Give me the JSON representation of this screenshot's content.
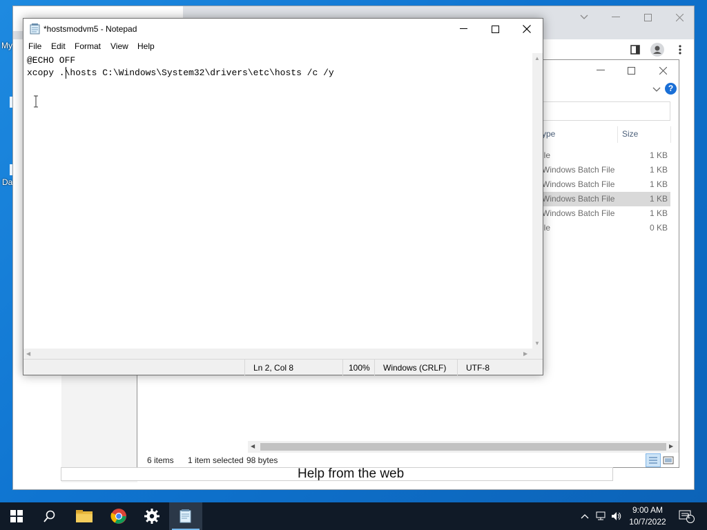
{
  "desktop": {
    "icon_labels": [
      "My",
      "Da"
    ]
  },
  "browser": {
    "help_from_web": "Help from the web"
  },
  "explorer": {
    "column_type": "ype",
    "column_size": "Size",
    "rows": [
      {
        "type": "ile",
        "size": "1 KB",
        "selected": false
      },
      {
        "type": "Windows Batch File",
        "size": "1 KB",
        "selected": false
      },
      {
        "type": "Windows Batch File",
        "size": "1 KB",
        "selected": false
      },
      {
        "type": "Windows Batch File",
        "size": "1 KB",
        "selected": true
      },
      {
        "type": "Windows Batch File",
        "size": "1 KB",
        "selected": false
      },
      {
        "type": "ile",
        "size": "0 KB",
        "selected": false
      }
    ],
    "status": {
      "items": "6 items",
      "selected": "1 item selected",
      "size": "98 bytes"
    }
  },
  "notepad": {
    "title": "*hostsmodvm5 - Notepad",
    "menu": [
      "File",
      "Edit",
      "Format",
      "View",
      "Help"
    ],
    "lines": [
      "@ECHO OFF",
      "xcopy .\\hosts C:\\Windows\\System32\\drivers\\etc\\hosts /c /y"
    ],
    "status": {
      "position": "Ln 2, Col 8",
      "zoom": "100%",
      "line_ending": "Windows (CRLF)",
      "encoding": "UTF-8"
    }
  },
  "taskbar": {
    "time": "9:00 AM",
    "date": "10/7/2022",
    "notification_count": "1"
  },
  "colors": {
    "desktop": "#0f74d0",
    "taskbar": "#101a27",
    "selection": "#d9d9d9",
    "help_icon": "#1a6fd6"
  }
}
